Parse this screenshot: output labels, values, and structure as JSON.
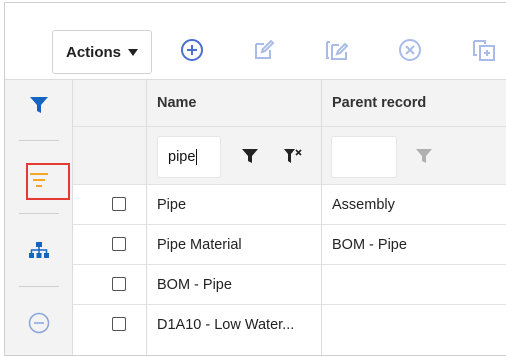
{
  "toolbar": {
    "actions_label": "Actions",
    "icons": [
      "add-circle-icon",
      "edit-icon",
      "bulk-edit-icon",
      "delete-circle-icon",
      "copy-icon"
    ],
    "icon_color": "#5b7fd4",
    "icon_disabled_color": "#a9bce8"
  },
  "rail": {
    "items": [
      "filter-icon",
      "sort-lines-icon",
      "hierarchy-icon",
      "collapse-icon"
    ],
    "active_color": "#1565c0",
    "sort_color": "#f5a623",
    "highlight_color": "#e53935"
  },
  "grid": {
    "columns": [
      "Name",
      "Parent record"
    ],
    "filters": {
      "name": "pipe",
      "parent": ""
    },
    "rows": [
      {
        "name": "Pipe",
        "parent": "Assembly"
      },
      {
        "name": "Pipe Material",
        "parent": "BOM - Pipe"
      },
      {
        "name": "BOM - Pipe",
        "parent": ""
      },
      {
        "name": "D1A10 - Low Water...",
        "parent": ""
      }
    ]
  }
}
